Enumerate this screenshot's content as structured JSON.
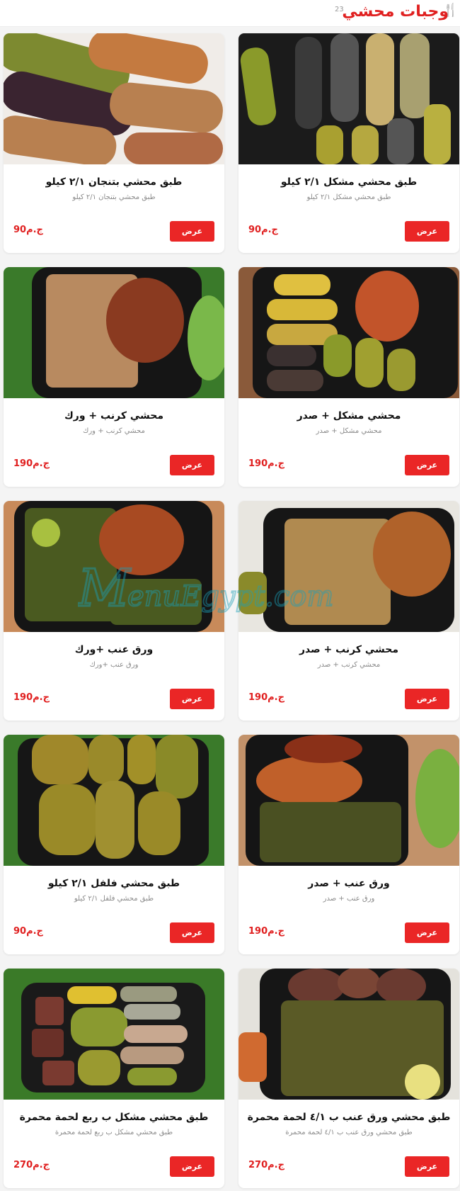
{
  "header": {
    "title": "وجبات محشي",
    "count": "23",
    "icon": "fork-knife-icon"
  },
  "colors": {
    "accent": "#e02020",
    "button": "#ea2626"
  },
  "watermark": "MenuEgypt.com",
  "items": [
    {
      "title": "طبق محشي مشكل ٢/١ كيلو",
      "desc": "طبق محشي مشكل ٢/١ كيلو",
      "price": "90ج.م",
      "button": "عرض",
      "image": "mixed-stuffed-vegetables-image"
    },
    {
      "title": "طبق محشي بتنجان ٢/١ كيلو",
      "desc": "طبق محشي بتنجان ٢/١ كيلو",
      "price": "90ج.م",
      "button": "عرض",
      "image": "stuffed-eggplant-image"
    },
    {
      "title": "محشي مشكل + صدر",
      "desc": "محشي مشكل + صدر",
      "price": "190ج.م",
      "button": "عرض",
      "image": "mixed-mahshi-chicken-breast-image"
    },
    {
      "title": "محشي كرنب + ورك",
      "desc": "محشي كرنب + ورك",
      "price": "190ج.م",
      "button": "عرض",
      "image": "cabbage-mahshi-chicken-leg-image"
    },
    {
      "title": "محشي كرنب + صدر",
      "desc": "محشي كرنب + صدر",
      "price": "190ج.م",
      "button": "عرض",
      "image": "cabbage-mahshi-chicken-breast-image"
    },
    {
      "title": "ورق عنب +ورك",
      "desc": "ورق عنب +ورك",
      "price": "190ج.م",
      "button": "عرض",
      "image": "vine-leaves-chicken-leg-image"
    },
    {
      "title": "ورق عنب + صدر",
      "desc": "ورق عنب + صدر",
      "price": "190ج.م",
      "button": "عرض",
      "image": "vine-leaves-chicken-breast-image"
    },
    {
      "title": "طبق محشي فلفل ٢/١ كيلو",
      "desc": "طبق محشي فلفل ٢/١ كيلو",
      "price": "90ج.م",
      "button": "عرض",
      "image": "stuffed-peppers-image"
    },
    {
      "title": "طبق محشي ورق عنب ب ٤/١ لحمة محمرة",
      "desc": "طبق محشي ورق عنب ب ٤/١ لحمة محمرة",
      "price": "270ج.م",
      "button": "عرض",
      "image": "vine-leaves-roasted-meat-image"
    },
    {
      "title": "طبق محشي مشكل ب ربع لحمة محمرة",
      "desc": "طبق محشي مشكل ب ربع لحمة محمرة",
      "price": "270ج.م",
      "button": "عرض",
      "image": "mixed-mahshi-roasted-meat-image"
    }
  ]
}
